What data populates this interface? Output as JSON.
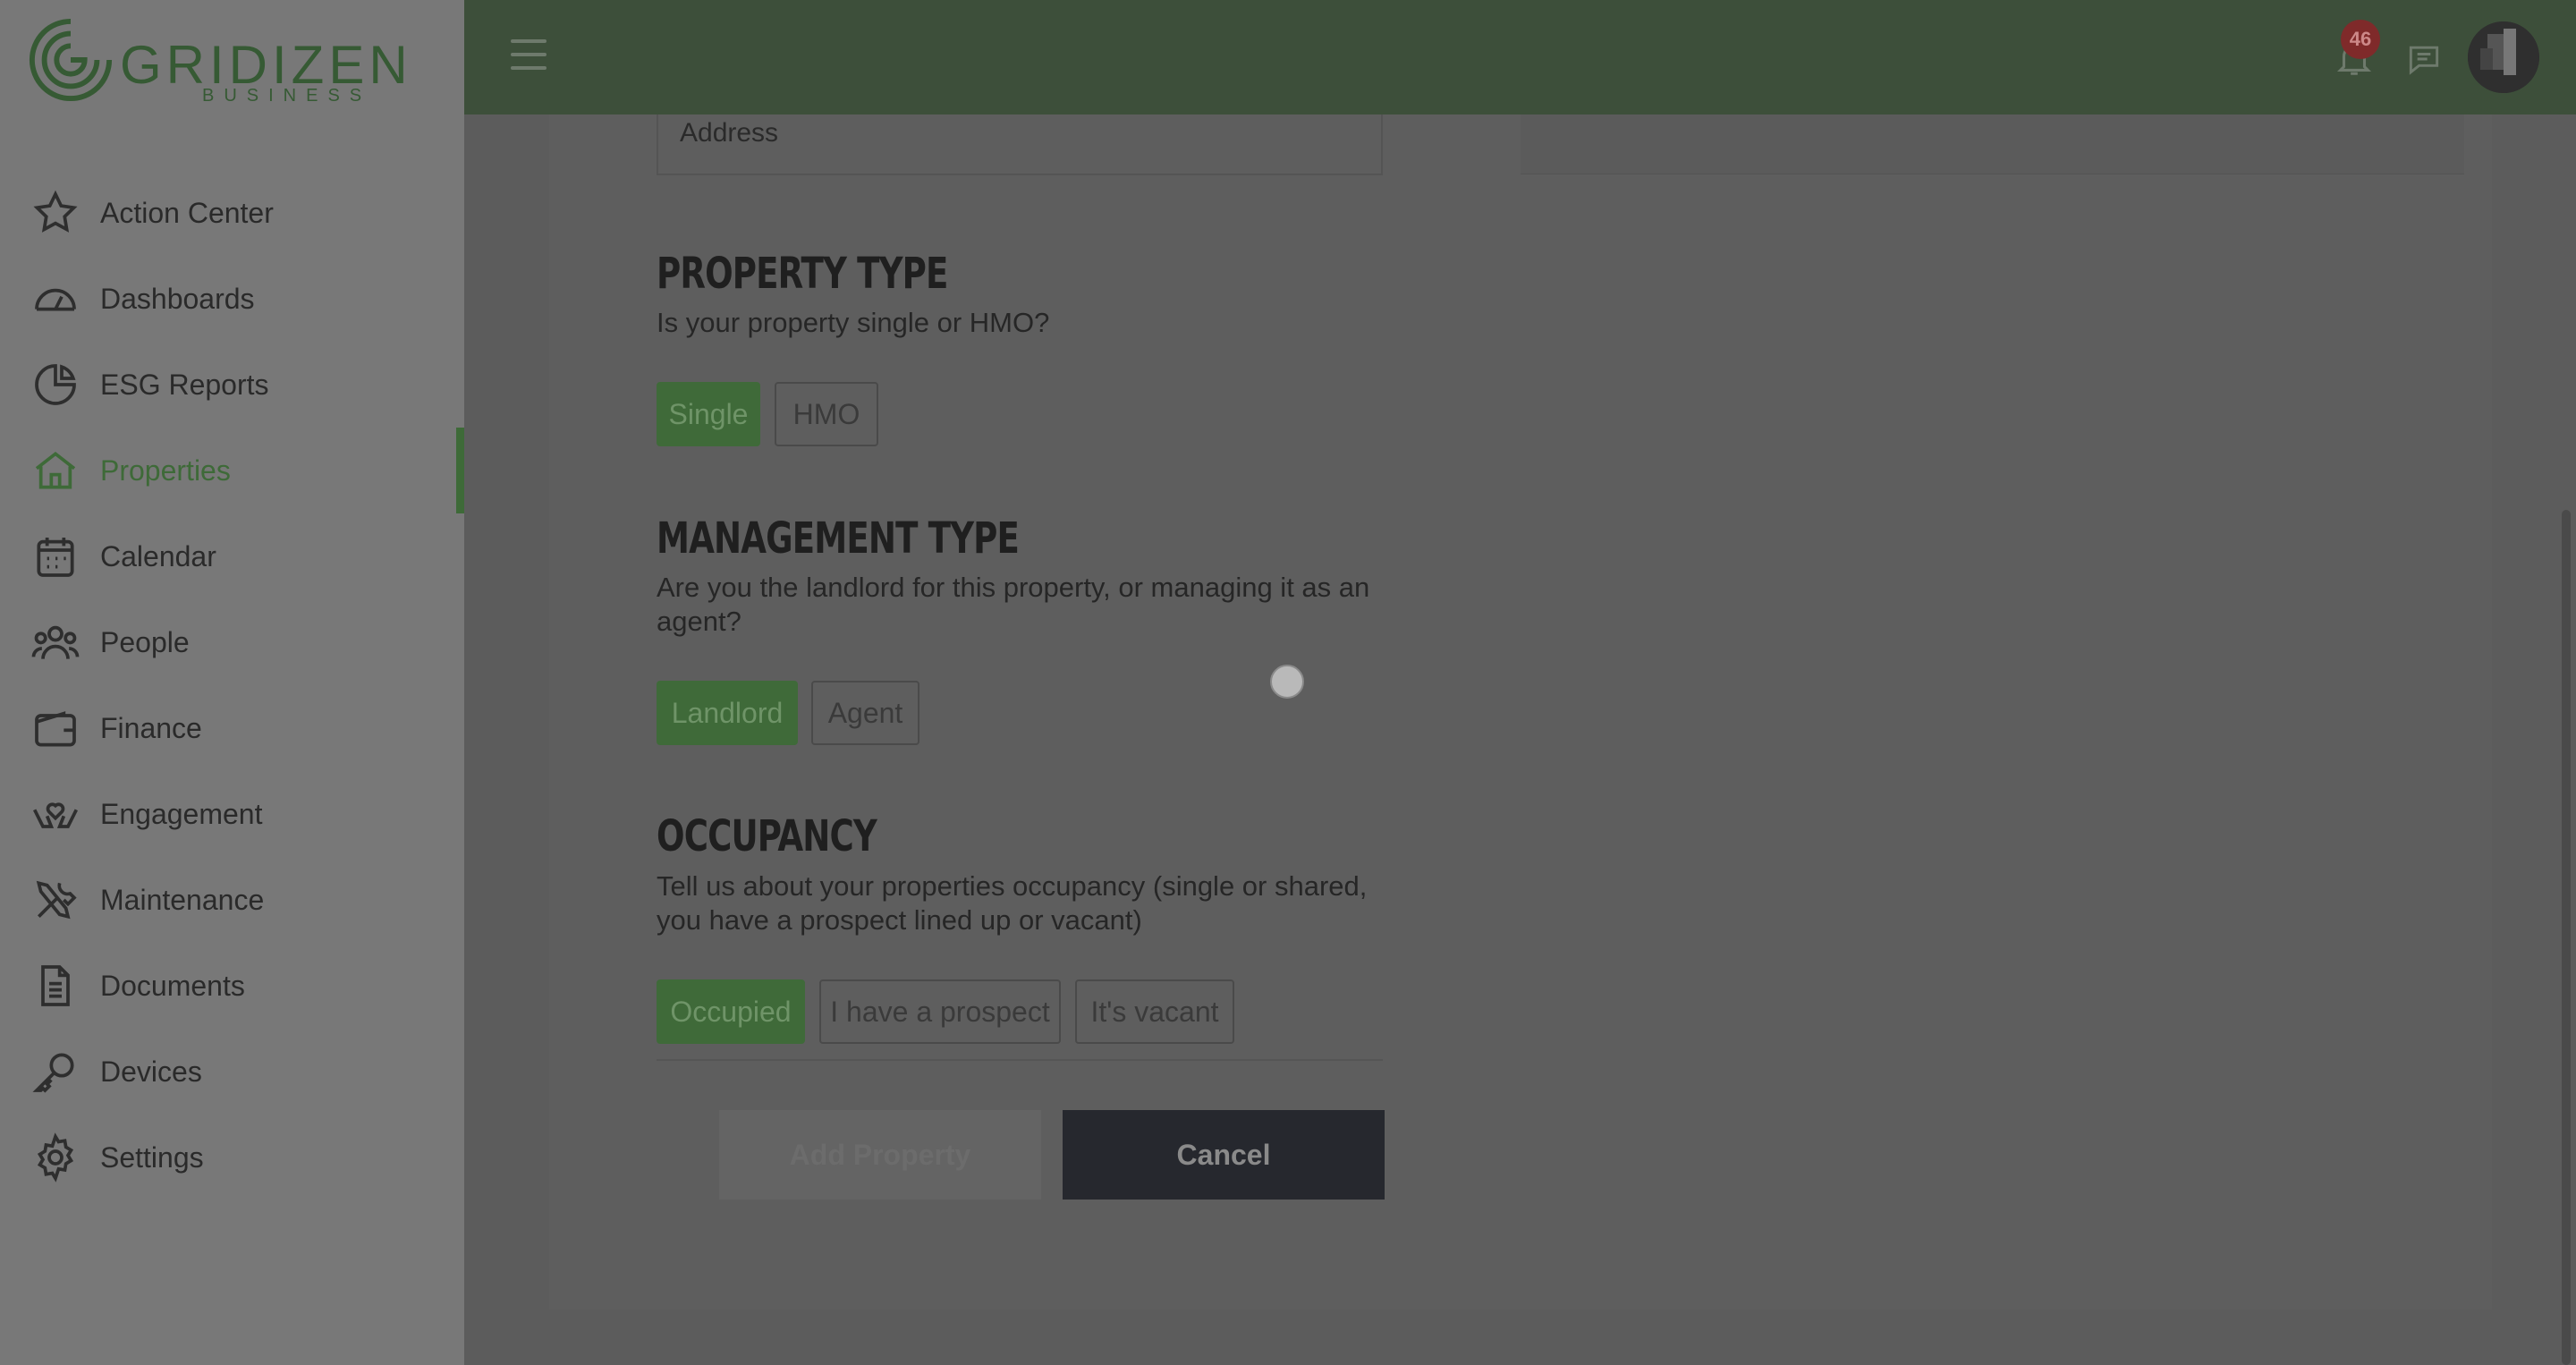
{
  "brand": {
    "name": "GRIDIZEN",
    "sub": "BUSINESS",
    "accent": "#3e6a38"
  },
  "sidebar": {
    "items": [
      {
        "label": "Action Center",
        "icon": "star-icon",
        "active": false
      },
      {
        "label": "Dashboards",
        "icon": "gauge-icon",
        "active": false
      },
      {
        "label": "ESG Reports",
        "icon": "pie-chart-icon",
        "active": false
      },
      {
        "label": "Properties",
        "icon": "home-icon",
        "active": true
      },
      {
        "label": "Calendar",
        "icon": "calendar-icon",
        "active": false
      },
      {
        "label": "People",
        "icon": "people-icon",
        "active": false
      },
      {
        "label": "Finance",
        "icon": "wallet-icon",
        "active": false
      },
      {
        "label": "Engagement",
        "icon": "heart-hands-icon",
        "active": false
      },
      {
        "label": "Maintenance",
        "icon": "tools-icon",
        "active": false
      },
      {
        "label": "Documents",
        "icon": "document-icon",
        "active": false
      },
      {
        "label": "Devices",
        "icon": "key-icon",
        "active": false
      },
      {
        "label": "Settings",
        "icon": "gear-icon",
        "active": false
      }
    ]
  },
  "topbar": {
    "notifications_count": "46"
  },
  "form": {
    "address_label": "Address",
    "property_type": {
      "title": "PROPERTY TYPE",
      "description": "Is your property single or HMO?",
      "options": [
        "Single",
        "HMO"
      ],
      "selected": "Single"
    },
    "management_type": {
      "title": "MANAGEMENT TYPE",
      "description": "Are you the landlord for this property, or managing it as an agent?",
      "options": [
        "Landlord",
        "Agent"
      ],
      "selected": "Landlord"
    },
    "occupancy": {
      "title": "OCCUPANCY",
      "description": "Tell us about your properties occupancy (single or shared, you have a prospect lined up or vacant)",
      "options": [
        "Occupied",
        "I have a prospect",
        "It's vacant"
      ],
      "selected": "Occupied"
    },
    "add_button": "Add Property",
    "cancel_button": "Cancel"
  }
}
